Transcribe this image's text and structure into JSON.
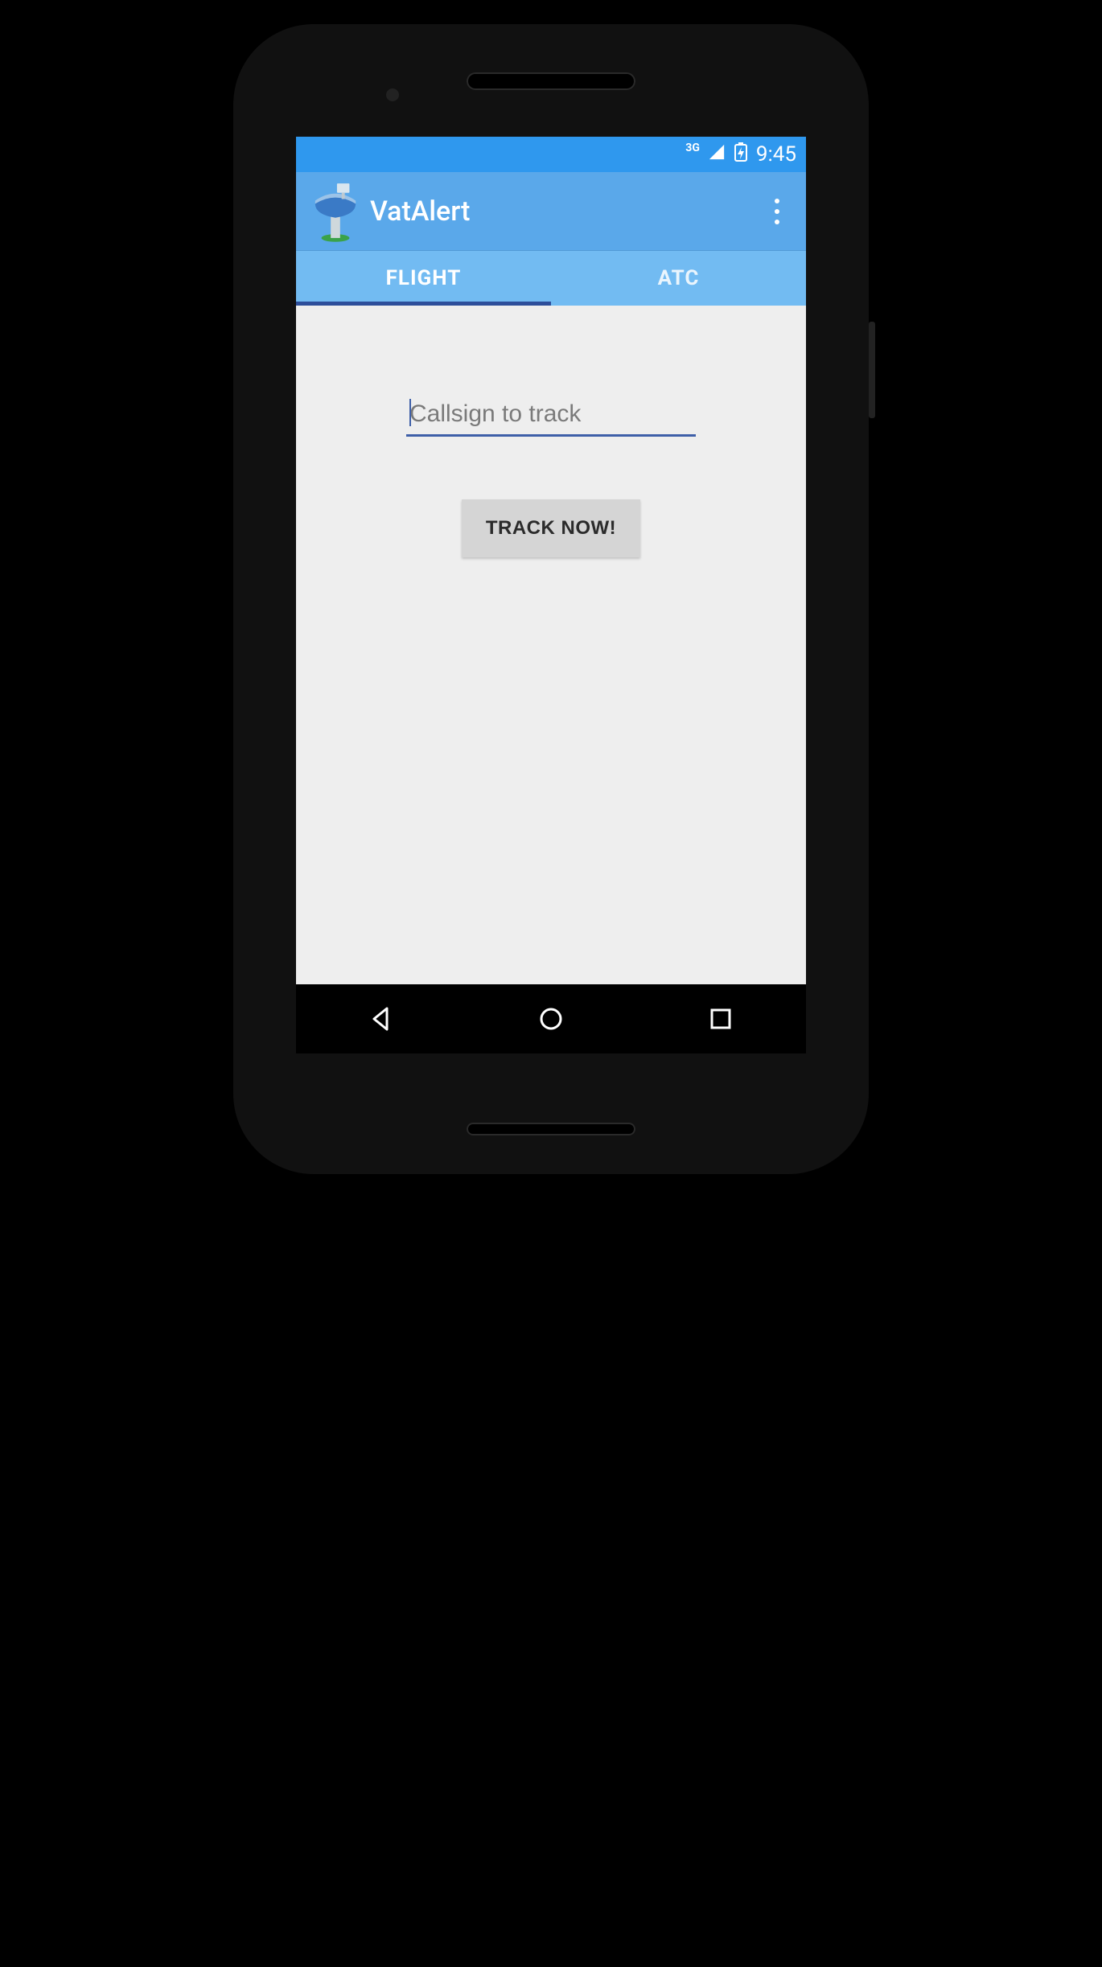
{
  "statusbar": {
    "network": "3G",
    "time": "9:45"
  },
  "appbar": {
    "title": "VatAlert"
  },
  "tabs": {
    "flight": "FLIGHT",
    "atc": "ATC"
  },
  "main": {
    "callsign_placeholder": "Callsign to track",
    "callsign_value": "",
    "track_button": "TRACK NOW!"
  }
}
